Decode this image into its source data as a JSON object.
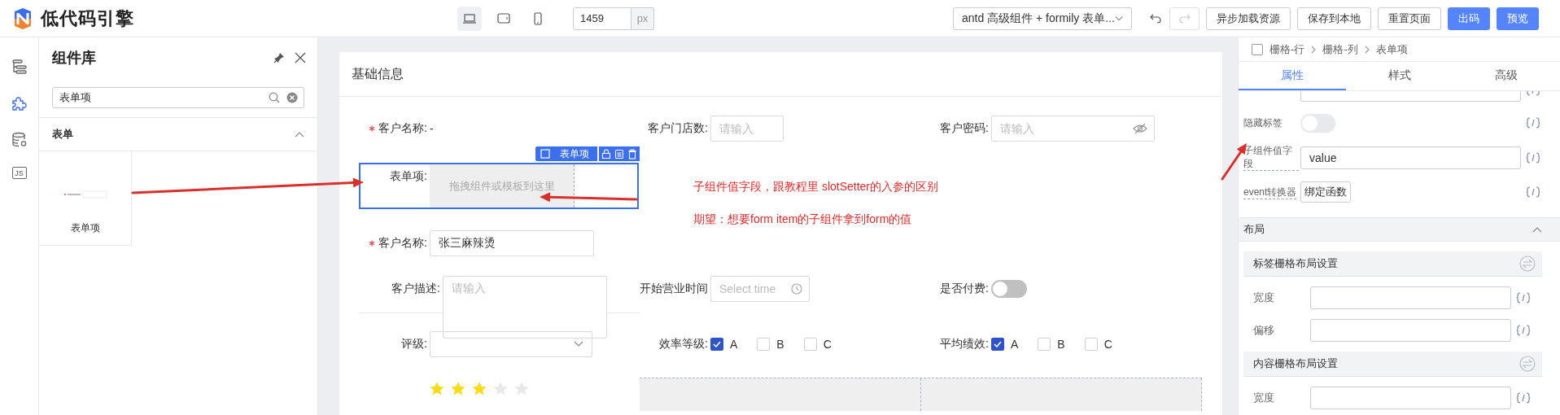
{
  "header": {
    "title": "低代码引擎",
    "devices": [
      {
        "kind": "desktop",
        "selected": true
      },
      {
        "kind": "tablet",
        "selected": false
      },
      {
        "kind": "phone",
        "selected": false
      }
    ],
    "canvas_width": {
      "value": "1459",
      "unit": "px"
    },
    "preset_select": {
      "value": "antd 高级组件 + formily 表单..."
    },
    "undo": {
      "disabled": false
    },
    "redo": {
      "disabled": true
    },
    "buttons": [
      {
        "label": "异步加载资源",
        "kind": "default"
      },
      {
        "label": "保存到本地",
        "kind": "default"
      },
      {
        "label": "重置页面",
        "kind": "default"
      },
      {
        "label": "出码",
        "kind": "primary"
      },
      {
        "label": "预览",
        "kind": "primary"
      }
    ]
  },
  "rail": [
    {
      "kind": "outline",
      "selected": false
    },
    {
      "kind": "components",
      "selected": true
    },
    {
      "kind": "datasource",
      "selected": false
    },
    {
      "kind": "code",
      "label": "JS",
      "selected": false
    }
  ],
  "component_panel": {
    "title": "组件库",
    "search": {
      "value": "表单项"
    },
    "groups": [
      {
        "title": "表单",
        "expanded": true,
        "items": [
          {
            "label": "表单项"
          }
        ]
      }
    ]
  },
  "canvas": {
    "card_title": "基础信息",
    "rows": [
      {
        "cells": [
          {
            "kind": "text",
            "label": "客户名称:",
            "required": true,
            "value": "-"
          },
          {
            "kind": "number",
            "label": "客户门店数:",
            "required": false,
            "placeholder": "请输入"
          },
          {
            "kind": "password",
            "label": "客户密码:",
            "required": false,
            "placeholder": "请输入"
          }
        ]
      },
      {
        "cells": [
          {
            "kind": "slot",
            "label": "表单项:",
            "required": false,
            "placeholder": "拖拽组件或模板到这里",
            "selected": true,
            "toolbar_label": "表单项"
          }
        ]
      },
      {
        "cells": [
          {
            "kind": "input",
            "label": "客户名称:",
            "required": true,
            "value": "张三麻辣烫"
          }
        ]
      },
      {
        "cells": [
          {
            "kind": "textarea",
            "label": "客户描述:",
            "required": false,
            "placeholder": "请输入"
          },
          {
            "kind": "time",
            "label": "开始营业时间",
            "required": false,
            "placeholder": "Select time"
          },
          {
            "kind": "switch",
            "label": "是否付费:",
            "required": false,
            "on": false
          }
        ]
      },
      {
        "cells": [
          {
            "kind": "select",
            "label": "评级:",
            "required": false
          },
          {
            "kind": "checkboxes",
            "label": "效率等级:",
            "required": false,
            "options": [
              {
                "label": "A",
                "checked": true
              },
              {
                "label": "B",
                "checked": false
              },
              {
                "label": "C",
                "checked": false
              }
            ]
          },
          {
            "kind": "checkboxes",
            "label": "平均绩效:",
            "required": false,
            "options": [
              {
                "label": "A",
                "checked": true
              },
              {
                "label": "B",
                "checked": false
              },
              {
                "label": "C",
                "checked": false
              }
            ]
          }
        ]
      },
      {
        "cells": [
          {
            "kind": "rate",
            "stars": 3
          },
          {
            "kind": "table"
          }
        ]
      }
    ]
  },
  "annotations": [
    "子组件值字段，跟教程里 slotSetter的入参的区别",
    "期望：想要form item的子组件拿到form的值"
  ],
  "settings_panel": {
    "breadcrumb": [
      "栅格-行",
      "栅格-列",
      "表单项"
    ],
    "tabs": [
      {
        "label": "属性",
        "selected": true
      },
      {
        "label": "样式",
        "selected": false
      },
      {
        "label": "高级",
        "selected": false
      }
    ],
    "props": [
      {
        "kind": "input"
      },
      {
        "kind": "switch",
        "label": "隐藏标签",
        "hint": false,
        "on": false
      },
      {
        "kind": "input",
        "label": "子组件值字段",
        "hint": true,
        "value": "value"
      },
      {
        "kind": "button",
        "label": "event转换器",
        "hint": true,
        "button": "绑定函数"
      }
    ],
    "sections": [
      {
        "title": "布局",
        "expanded": true,
        "groups": [
          {
            "title": "标签栅格布局设置",
            "fields": [
              {
                "label": "宽度"
              },
              {
                "label": "偏移"
              }
            ]
          },
          {
            "title": "内容栅格布局设置",
            "fields": [
              {
                "label": "宽度"
              }
            ]
          }
        ]
      }
    ]
  }
}
